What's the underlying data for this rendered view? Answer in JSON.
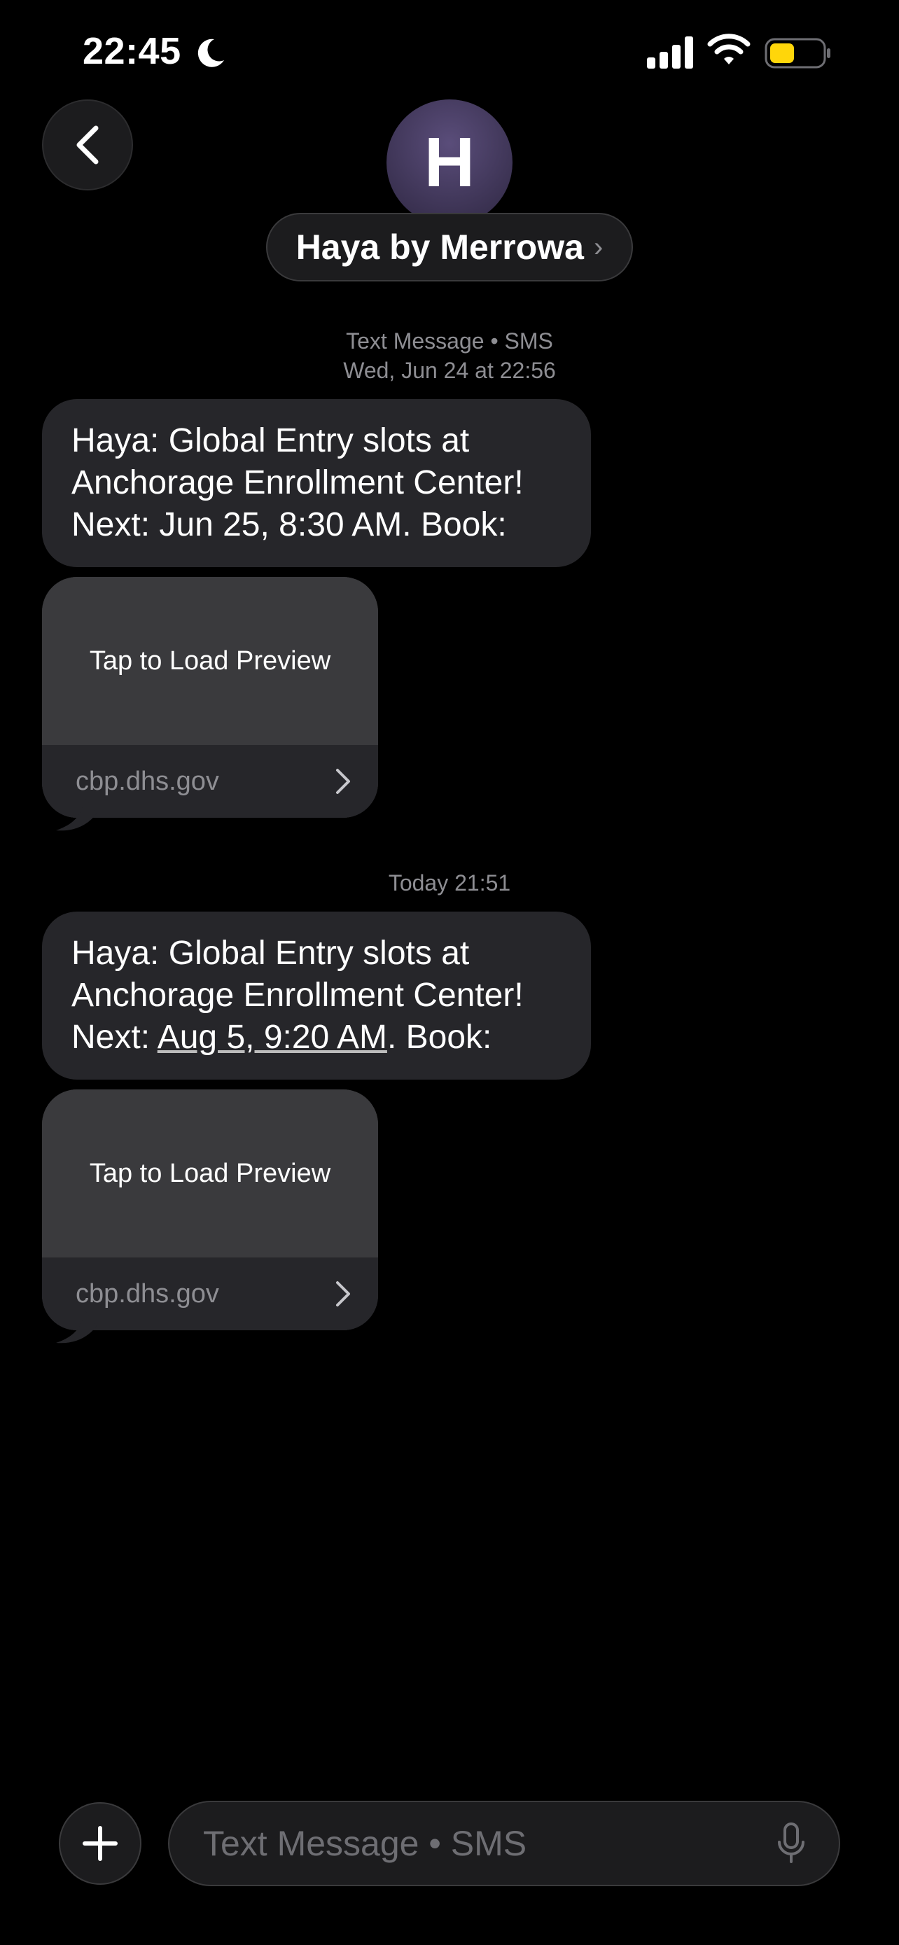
{
  "status_bar": {
    "time": "22:45",
    "icons": [
      "moon-icon",
      "cellular-signal-icon",
      "wifi-icon",
      "battery-icon"
    ],
    "battery_color": "#FFD60A"
  },
  "header": {
    "back_icon": "chevron-left-icon",
    "avatar_initial": "H",
    "contact_name": "Haya by Merrowa",
    "contact_chevron": "›"
  },
  "thread": {
    "groups": [
      {
        "timestamp_line1": "Text Message • SMS",
        "timestamp_line2": "Wed, Jun 24 at 22:56",
        "message_prefix": "Haya: Global Entry slots at Anchorage Enrollment Center! Next: ",
        "message_date": "Jun 25, 8:30 AM",
        "message_suffix": ". Book:",
        "link_preview": "Tap to Load Preview",
        "link_domain": "cbp.dhs.gov"
      },
      {
        "timestamp_line1": "Today 21:51",
        "message_prefix": "Haya: Global Entry slots at Anchorage Enrollment Center! Next: ",
        "message_date": "Aug 5, 9:20 AM",
        "message_suffix": ". Book:",
        "link_preview": "Tap to Load Preview",
        "link_domain": "cbp.dhs.gov"
      }
    ]
  },
  "composer": {
    "plus_icon": "plus-icon",
    "placeholder": "Text Message • SMS",
    "value": "",
    "mic_icon": "microphone-icon"
  },
  "colors": {
    "background": "#000000",
    "bubble_received": "#26262A",
    "link_preview_top": "#3A3A3D",
    "secondary_text": "#8E8E93"
  }
}
